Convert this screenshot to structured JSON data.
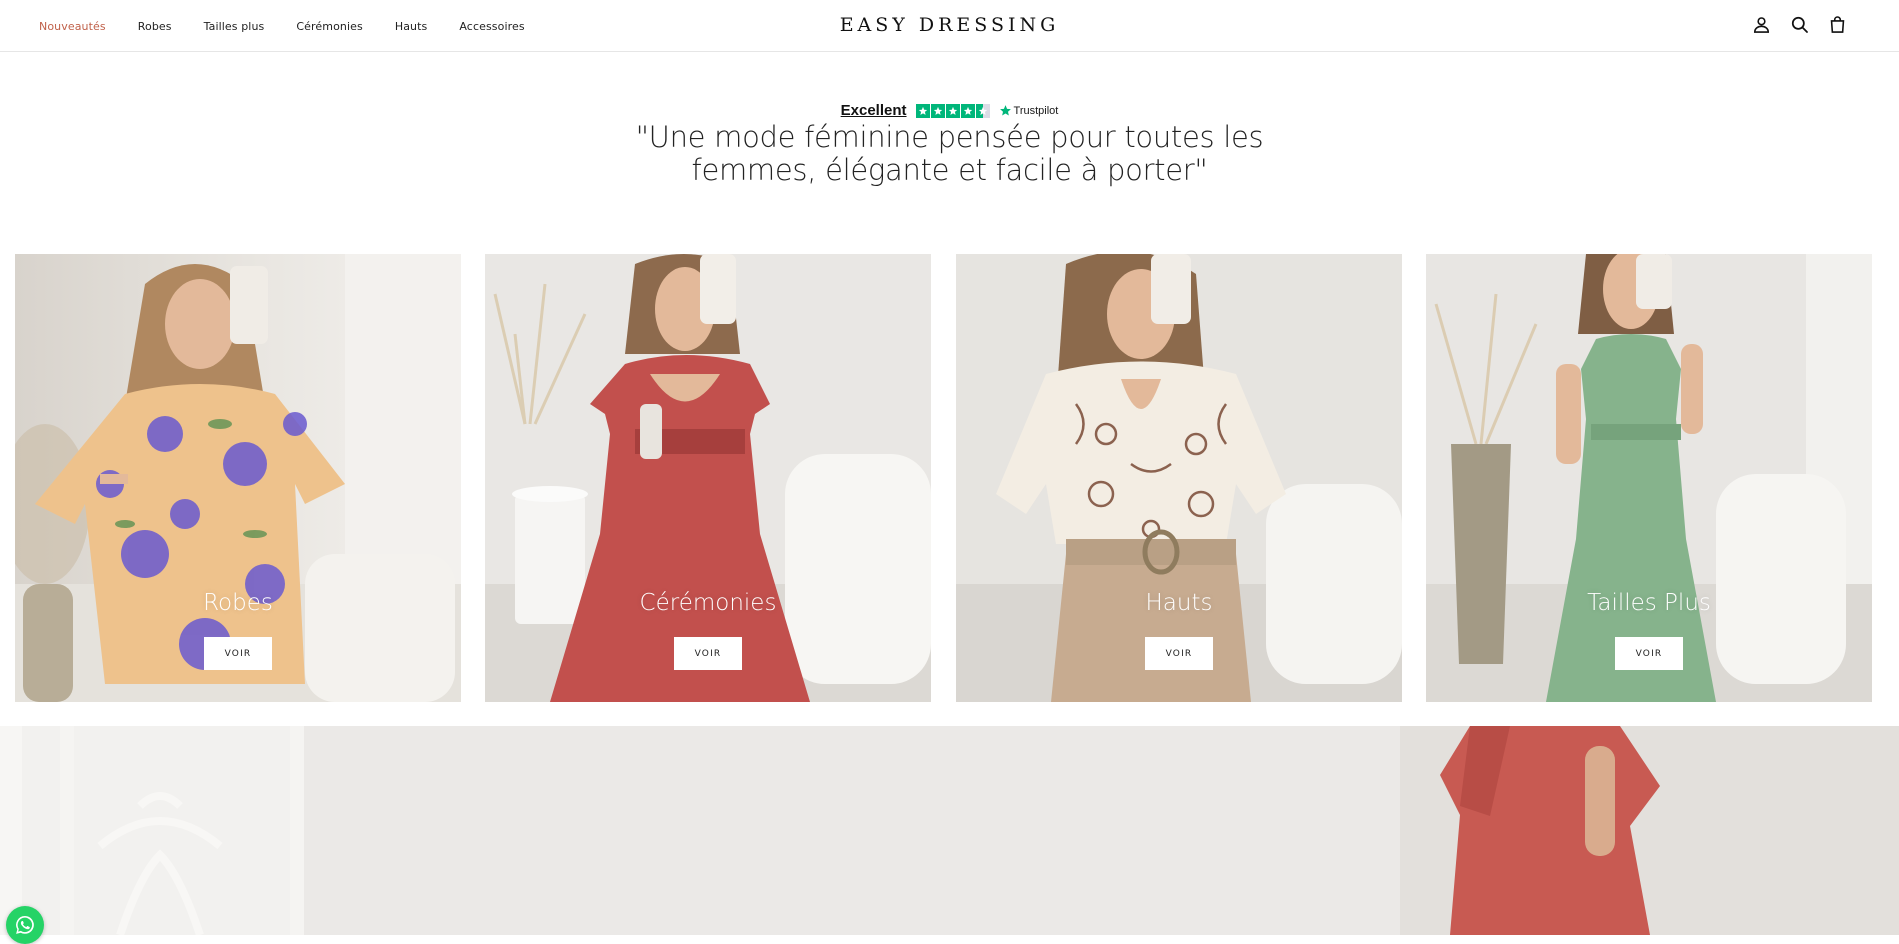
{
  "header": {
    "nav": [
      {
        "label": "Nouveautés",
        "active": true
      },
      {
        "label": "Robes",
        "active": false
      },
      {
        "label": "Tailles plus",
        "active": false
      },
      {
        "label": "Cérémonies",
        "active": false
      },
      {
        "label": "Hauts",
        "active": false
      },
      {
        "label": "Accessoires",
        "active": false
      }
    ],
    "logo": "EASY DRESSING",
    "icons": [
      "account-icon",
      "search-icon",
      "cart-icon"
    ],
    "active_color": "#c0614a"
  },
  "trustpilot": {
    "rating_label": "Excellent",
    "stars": 4.5,
    "brand": "Trustpilot",
    "star_color": "#00b67a"
  },
  "tagline": {
    "line1": "\"Une mode féminine pensée pour toutes les",
    "line2": "femmes, élégante et facile à porter\""
  },
  "categories": [
    {
      "title": "Robes",
      "button": "VOIR",
      "image": "floral-dress-photo"
    },
    {
      "title": "Cérémonies",
      "button": "VOIR",
      "image": "red-dress-photo"
    },
    {
      "title": "Hauts",
      "button": "VOIR",
      "image": "embroidered-blouse-photo"
    },
    {
      "title": "Tailles Plus",
      "button": "VOIR",
      "image": "green-dress-photo"
    }
  ],
  "whatsapp": {
    "icon": "whatsapp-icon",
    "color": "#25d366"
  }
}
